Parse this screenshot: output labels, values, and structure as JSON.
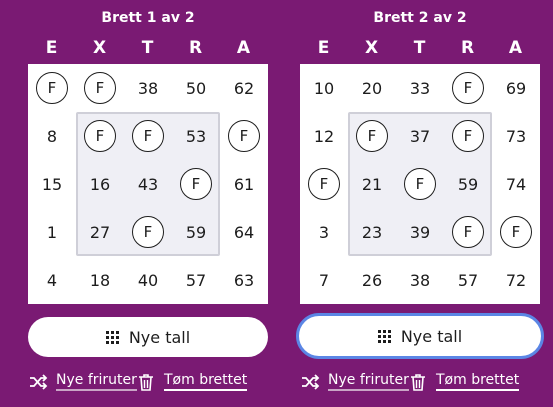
{
  "columns": [
    "E",
    "X",
    "T",
    "R",
    "A"
  ],
  "boards": [
    {
      "title": "Brett 1 av 2",
      "rows": [
        [
          "F",
          "F",
          "38",
          "50",
          "62"
        ],
        [
          "8",
          "F",
          "F",
          "53",
          "F"
        ],
        [
          "15",
          "16",
          "43",
          "F",
          "61"
        ],
        [
          "1",
          "27",
          "F",
          "59",
          "64"
        ],
        [
          "4",
          "18",
          "40",
          "57",
          "63"
        ]
      ],
      "new_numbers_label": "Nye tall",
      "shuffle_free_label": "Nye friruter",
      "clear_board_label": "Tøm brettet"
    },
    {
      "title": "Brett 2 av 2",
      "rows": [
        [
          "10",
          "20",
          "33",
          "F",
          "69"
        ],
        [
          "12",
          "F",
          "37",
          "F",
          "73"
        ],
        [
          "F",
          "21",
          "F",
          "59",
          "74"
        ],
        [
          "3",
          "23",
          "39",
          "F",
          "F"
        ],
        [
          "7",
          "26",
          "38",
          "57",
          "72"
        ]
      ],
      "new_numbers_label": "Nye tall",
      "shuffle_free_label": "Nye friruter",
      "clear_board_label": "Tøm brettet"
    }
  ],
  "colors": {
    "background": "#7a1a73",
    "focus_ring": "#5b86e5"
  },
  "icons": {
    "grid": "grid-dots-icon",
    "shuffle": "shuffle-icon",
    "trash": "trash-icon"
  },
  "focused_button": 1
}
